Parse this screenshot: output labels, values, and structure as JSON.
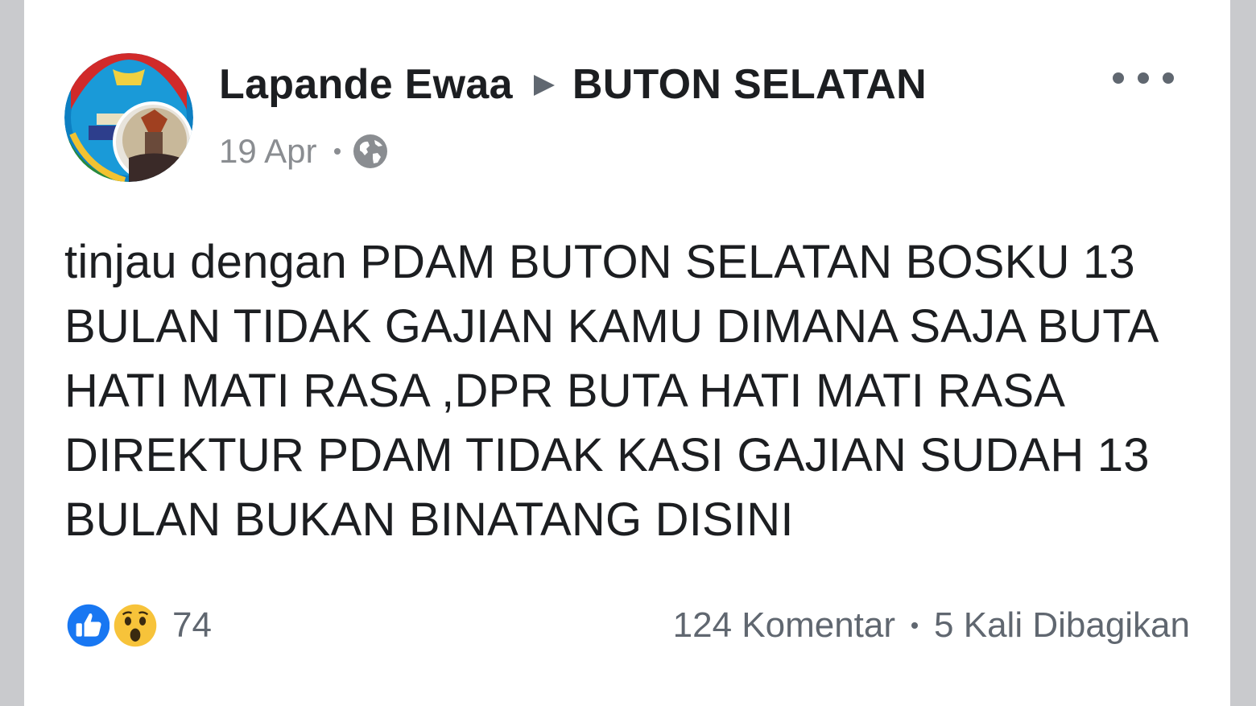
{
  "post": {
    "author": "Lapande Ewaa",
    "group": "BUTON SELATAN",
    "timestamp": "19 Apr",
    "privacy_icon": "globe-icon",
    "text": "tinjau dengan PDAM BUTON SELATAN BOSKU 13 BULAN TIDAK GAJIAN KAMU DIMANA SAJA BUTA HATI MATI RASA ,DPR BUTA HATI MATI RASA DIREKTUR PDAM TIDAK KASI GAJIAN SUDAH 13 BULAN BUKAN BINATANG DISINI"
  },
  "reactions": {
    "icons": [
      "like-icon",
      "wow-icon"
    ],
    "count": "74"
  },
  "stats": {
    "comments": "124 Komentar",
    "shares": "5 Kali Dibagikan"
  },
  "colors": {
    "background": "#c9cacd",
    "card": "#ffffff",
    "text": "#1c1e21",
    "muted": "#8a8d91",
    "like_blue": "#1877f2",
    "wow_yellow": "#f7c33a"
  }
}
